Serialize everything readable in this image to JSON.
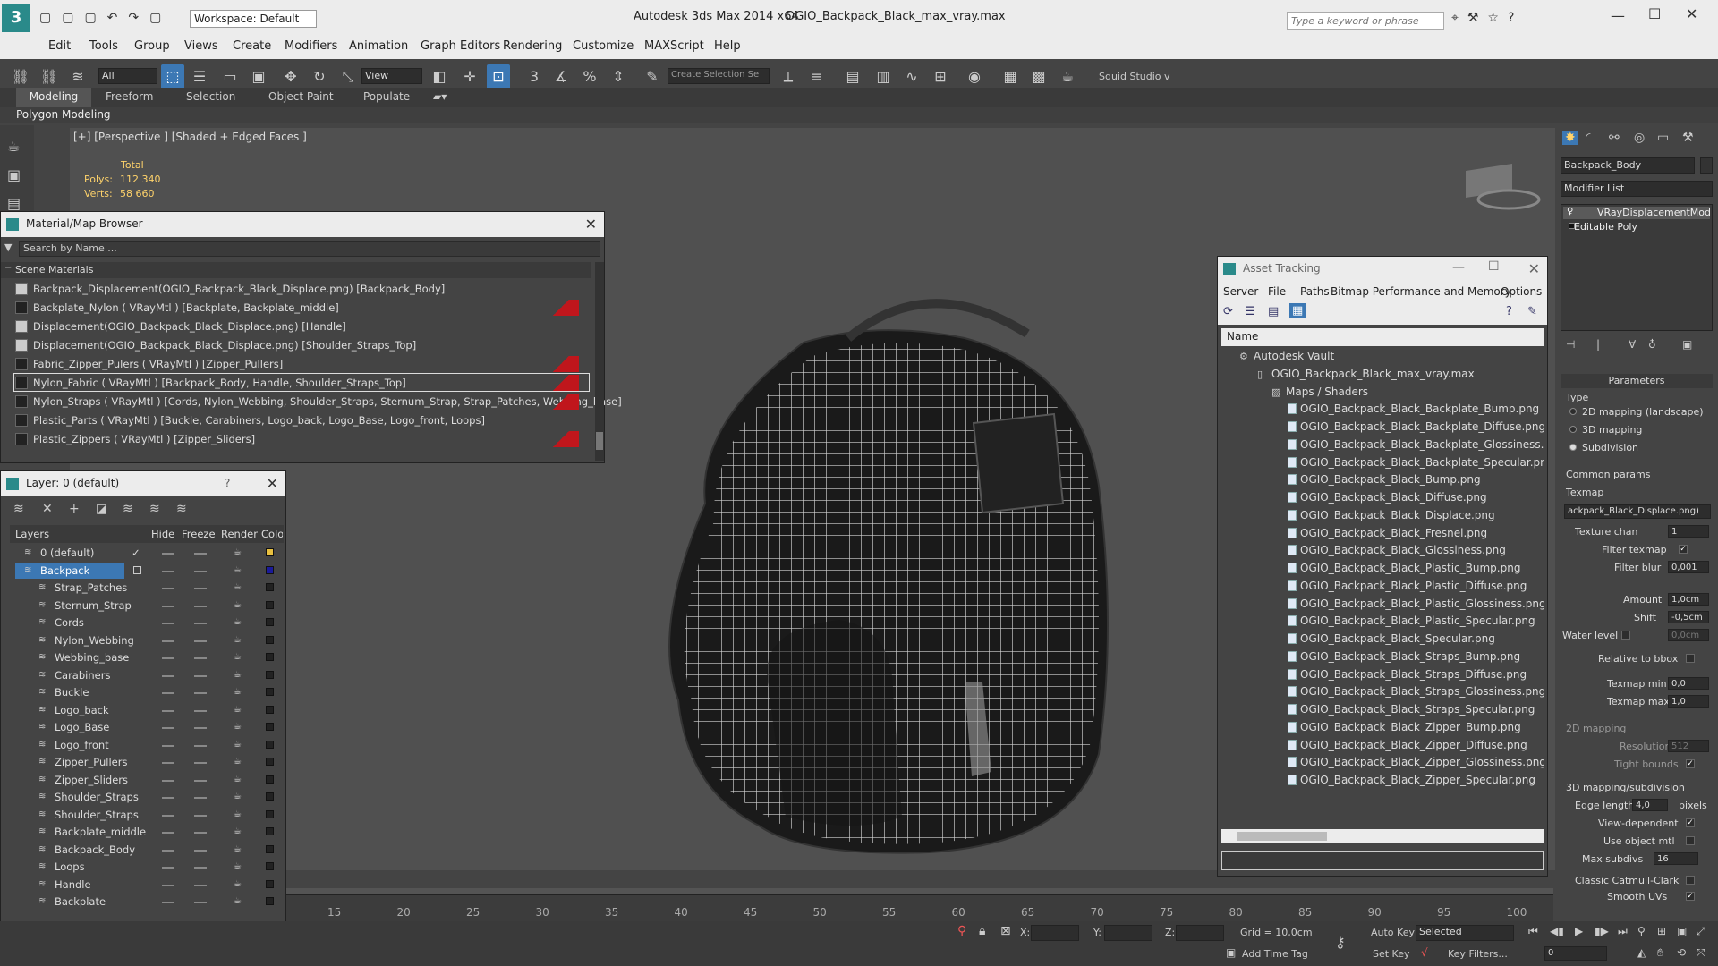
{
  "window": {
    "workspace": "Workspace: Default",
    "app_title": "Autodesk 3ds Max  2014 x64",
    "file": "OGIO_Backpack_Black_max_vray.max",
    "search_placeholder": "Type a keyword or phrase"
  },
  "menu": [
    "Edit",
    "Tools",
    "Group",
    "Views",
    "Create",
    "Modifiers",
    "Animation",
    "Graph Editors",
    "Rendering",
    "Customize",
    "MAXScript",
    "Help"
  ],
  "toolbar": {
    "filter": "All",
    "view": "View",
    "selection_set": "Create Selection Se",
    "squid": "Squid Studio v"
  },
  "ribbon": {
    "tabs": [
      "Modeling",
      "Freeform",
      "Selection",
      "Object Paint",
      "Populate"
    ],
    "sub": "Polygon Modeling"
  },
  "viewport": {
    "label": "[+] [Perspective ] [Shaded + Edged Faces ]",
    "total": "Total",
    "polys_label": "Polys:",
    "polys": "112 340",
    "verts_label": "Verts:",
    "verts": "58 660"
  },
  "mat_browser": {
    "title": "Material/Map Browser",
    "search": "Search by Name ...",
    "section": "Scene Materials",
    "items": [
      "Backpack_Displacement(OGIO_Backpack_Black_Displace.png) [Backpack_Body]",
      "Backplate_Nylon ( VRayMtl ) [Backplate, Backplate_middle]",
      "Displacement(OGIO_Backpack_Black_Displace.png) [Handle]",
      "Displacement(OGIO_Backpack_Black_Displace.png) [Shoulder_Straps_Top]",
      "Fabric_Zipper_Pulers ( VRayMtl ) [Zipper_Pullers]",
      "Nylon_Fabric ( VRayMtl ) [Backpack_Body, Handle, Shoulder_Straps_Top]",
      "Nylon_Straps ( VRayMtl ) [Cords, Nylon_Webbing, Shoulder_Straps, Sternum_Strap, Strap_Patches, Webbing_base]",
      "Plastic_Parts ( VRayMtl ) [Buckle, Carabiners, Logo_back, Logo_Base, Logo_front, Loops]",
      "Plastic_Zippers ( VRayMtl ) [Zipper_Sliders]"
    ]
  },
  "layers": {
    "title": "Layer: 0 (default)",
    "help": "?",
    "cols": [
      "Layers",
      "Hide",
      "Freeze",
      "Render",
      "Color"
    ],
    "top": [
      "0 (default)",
      "Backpack"
    ],
    "children": [
      "Strap_Patches",
      "Sternum_Strap",
      "Cords",
      "Nylon_Webbing",
      "Webbing_base",
      "Carabiners",
      "Buckle",
      "Logo_back",
      "Logo_Base",
      "Logo_front",
      "Zipper_Pullers",
      "Zipper_Sliders",
      "Shoulder_Straps",
      "Shoulder_Straps",
      "Backplate_middle",
      "Backpack_Body",
      "Loops",
      "Handle",
      "Backplate"
    ],
    "default_color": "#e8c040",
    "backpack_color": "#1a1a9a"
  },
  "asset": {
    "title": "Asset Tracking",
    "menu": [
      "Server",
      "File",
      "Paths",
      "Bitmap Performance and Memory",
      "Options"
    ],
    "col": "Name",
    "vault": "Autodesk Vault",
    "file": "OGIO_Backpack_Black_max_vray.max",
    "maps": "Maps / Shaders",
    "files": [
      "OGIO_Backpack_Black_Backplate_Bump.png",
      "OGIO_Backpack_Black_Backplate_Diffuse.png",
      "OGIO_Backpack_Black_Backplate_Glossiness.png",
      "OGIO_Backpack_Black_Backplate_Specular.png",
      "OGIO_Backpack_Black_Bump.png",
      "OGIO_Backpack_Black_Diffuse.png",
      "OGIO_Backpack_Black_Displace.png",
      "OGIO_Backpack_Black_Fresnel.png",
      "OGIO_Backpack_Black_Glossiness.png",
      "OGIO_Backpack_Black_Plastic_Bump.png",
      "OGIO_Backpack_Black_Plastic_Diffuse.png",
      "OGIO_Backpack_Black_Plastic_Glossiness.png",
      "OGIO_Backpack_Black_Plastic_Specular.png",
      "OGIO_Backpack_Black_Specular.png",
      "OGIO_Backpack_Black_Straps_Bump.png",
      "OGIO_Backpack_Black_Straps_Diffuse.png",
      "OGIO_Backpack_Black_Straps_Glossiness.png",
      "OGIO_Backpack_Black_Straps_Specular.png",
      "OGIO_Backpack_Black_Zipper_Bump.png",
      "OGIO_Backpack_Black_Zipper_Diffuse.png",
      "OGIO_Backpack_Black_Zipper_Glossiness.png",
      "OGIO_Backpack_Black_Zipper_Specular.png"
    ]
  },
  "cmd": {
    "object": "Backpack_Body",
    "modlist": "Modifier List",
    "stack": [
      "VRayDisplacementMod",
      "Editable Poly"
    ],
    "params": "Parameters",
    "type": "Type",
    "types": [
      "2D mapping (landscape)",
      "3D mapping",
      "Subdivision"
    ],
    "common": "Common params",
    "texmap": "Texmap",
    "texmap_val": "ackpack_Black_Displace.png)",
    "texchan": "Texture chan",
    "texchan_v": "1",
    "filter_texmap": "Filter texmap",
    "filter_blur": "Filter blur",
    "filter_blur_v": "0,001",
    "amount": "Amount",
    "amount_v": "1,0cm",
    "shift": "Shift",
    "shift_v": "-0,5cm",
    "water": "Water level",
    "water_v": "0,0cm",
    "relbbox": "Relative to bbox",
    "tmin": "Texmap min",
    "tmin_v": "0,0",
    "tmax": "Texmap max",
    "tmax_v": "1,0",
    "map2d": "2D mapping",
    "res": "Resolution",
    "res_v": "512",
    "tight": "Tight bounds",
    "map3d": "3D mapping/subdivision",
    "edge": "Edge length",
    "edge_v": "4,0",
    "pixels": "pixels",
    "viewdep": "View-dependent",
    "useobj": "Use object mtl",
    "maxsub": "Max subdivs",
    "maxsub_v": "16",
    "catmull": "Classic Catmull-Clark",
    "smooth": "Smooth UVs"
  },
  "timeline": {
    "ticks": [
      "15",
      "20",
      "25",
      "30",
      "35",
      "40",
      "45",
      "50",
      "55",
      "60",
      "65",
      "70",
      "75",
      "80",
      "85",
      "90",
      "95",
      "100"
    ]
  },
  "status": {
    "x": "X:",
    "y": "Y:",
    "z": "Z:",
    "grid": "Grid = 10,0cm",
    "autokey": "Auto Key",
    "selected": "Selected",
    "setkey": "Set Key",
    "keyfilters": "Key Filters...",
    "addtime": "Add Time Tag",
    "frame": "0"
  }
}
